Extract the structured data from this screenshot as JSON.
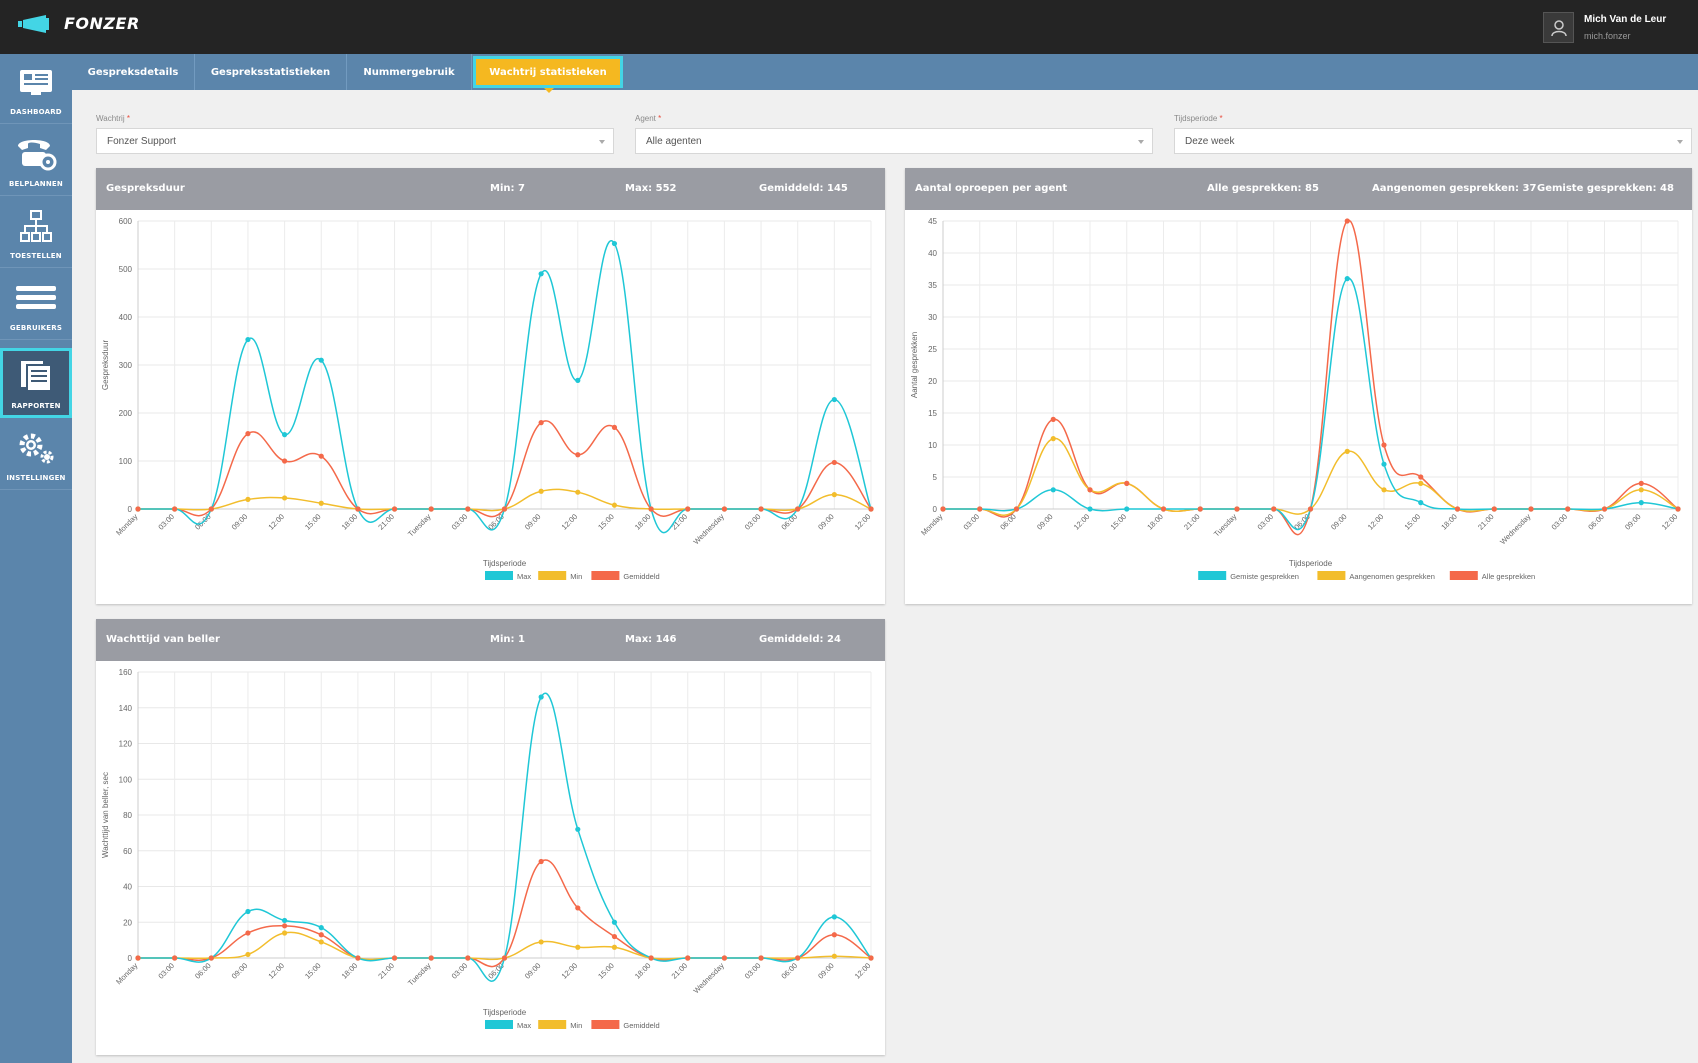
{
  "app": {
    "title": "FONZER"
  },
  "user": {
    "name": "Mich Van de Leur",
    "username": "mich.fonzer"
  },
  "sidebar": {
    "items": [
      {
        "label": "DASHBOARD",
        "icon": "dashboard-icon"
      },
      {
        "label": "BELPLANNEN",
        "icon": "phone-gear-icon"
      },
      {
        "label": "TOESTELLEN",
        "icon": "network-icon"
      },
      {
        "label": "GEBRUIKERS",
        "icon": "menu-icon"
      },
      {
        "label": "RAPPORTEN",
        "icon": "reports-icon",
        "active": true
      },
      {
        "label": "INSTELLINGEN",
        "icon": "gears-icon"
      }
    ]
  },
  "tabs": [
    {
      "label": "Gespreksdetails"
    },
    {
      "label": "Gespreksstatistieken"
    },
    {
      "label": "Nummergebruik"
    },
    {
      "label": "Wachtrij statistieken",
      "active": true
    }
  ],
  "filters": {
    "queue": {
      "label": "Wachtrij",
      "value": "Fonzer Support"
    },
    "agent": {
      "label": "Agent",
      "value": "Alle agenten"
    },
    "period": {
      "label": "Tijdsperiode",
      "value": "Deze week"
    }
  },
  "colors": {
    "max": "#1fc7d6",
    "min": "#f2bd2c",
    "avg": "#f4694a"
  },
  "panels": {
    "duration": {
      "title": "Gespreksduur",
      "min": "Min: 7",
      "max": "Max: 552",
      "avg": "Gemiddeld: 145"
    },
    "calls": {
      "title": "Aantal oproepen per agent",
      "all": "Alle gesprekken: 85",
      "answered": "Aangenomen gesprekken: 37",
      "missed": "Gemiste gesprekken: 48"
    },
    "wait": {
      "title": "Wachttijd van beller",
      "min": "Min: 1",
      "max": "Max: 146",
      "avg": "Gemiddeld: 24"
    }
  },
  "chart_data": [
    {
      "type": "line",
      "categories": [
        "Monday",
        "03:00",
        "06:00",
        "09:00",
        "12:00",
        "15:00",
        "18:00",
        "21:00",
        "Tuesday",
        "03:00",
        "06:00",
        "09:00",
        "12:00",
        "15:00",
        "18:00",
        "21:00",
        "Wednesday",
        "03:00",
        "06:00",
        "09:00",
        "12:00"
      ],
      "ylabel": "Gespreksduur",
      "xlabel": "Tijdsperiode",
      "ylim": [
        0,
        600
      ],
      "yticks": [
        0,
        100,
        200,
        300,
        400,
        500,
        600
      ],
      "series": [
        {
          "name": "Max",
          "color": "#1fc7d6",
          "values": [
            0,
            0,
            0,
            353,
            155,
            310,
            0,
            0,
            0,
            0,
            0,
            490,
            268,
            553,
            0,
            0,
            0,
            0,
            0,
            228,
            0
          ]
        },
        {
          "name": "Min",
          "color": "#f2bd2c",
          "values": [
            0,
            0,
            0,
            20,
            23,
            12,
            0,
            0,
            0,
            0,
            0,
            37,
            35,
            8,
            0,
            0,
            0,
            0,
            0,
            30,
            0
          ]
        },
        {
          "name": "Gemiddeld",
          "color": "#f4694a",
          "values": [
            0,
            0,
            0,
            157,
            100,
            110,
            0,
            0,
            0,
            0,
            0,
            180,
            113,
            170,
            0,
            0,
            0,
            0,
            0,
            97,
            0
          ]
        }
      ]
    },
    {
      "type": "line",
      "categories": [
        "Monday",
        "03:00",
        "06:00",
        "09:00",
        "12:00",
        "15:00",
        "18:00",
        "21:00",
        "Tuesday",
        "03:00",
        "06:00",
        "09:00",
        "12:00",
        "15:00",
        "18:00",
        "21:00",
        "Wednesday",
        "03:00",
        "06:00",
        "09:00",
        "12:00"
      ],
      "ylabel": "Aantal gesprekken",
      "xlabel": "Tijdsperiode",
      "ylim": [
        0,
        45
      ],
      "yticks": [
        0,
        5,
        10,
        15,
        20,
        25,
        30,
        35,
        40,
        45
      ],
      "series": [
        {
          "name": "Gemiste gesprekken",
          "color": "#1fc7d6",
          "values": [
            0,
            0,
            0,
            3,
            0,
            0,
            0,
            0,
            0,
            0,
            0,
            36,
            7,
            1,
            0,
            0,
            0,
            0,
            0,
            1,
            0
          ]
        },
        {
          "name": "Aangenomen gesprekken",
          "color": "#f2bd2c",
          "values": [
            0,
            0,
            0,
            11,
            3,
            4,
            0,
            0,
            0,
            0,
            0,
            9,
            3,
            4,
            0,
            0,
            0,
            0,
            0,
            3,
            0
          ]
        },
        {
          "name": "Alle gesprekken",
          "color": "#f4694a",
          "values": [
            0,
            0,
            0,
            14,
            3,
            4,
            0,
            0,
            0,
            0,
            0,
            45,
            10,
            5,
            0,
            0,
            0,
            0,
            0,
            4,
            0
          ]
        }
      ]
    },
    {
      "type": "line",
      "categories": [
        "Monday",
        "03:00",
        "06:00",
        "09:00",
        "12:00",
        "15:00",
        "18:00",
        "21:00",
        "Tuesday",
        "03:00",
        "06:00",
        "09:00",
        "12:00",
        "15:00",
        "18:00",
        "21:00",
        "Wednesday",
        "03:00",
        "06:00",
        "09:00",
        "12:00"
      ],
      "ylabel": "Wachttijd van beller, sec",
      "xlabel": "Tijdsperiode",
      "ylim": [
        0,
        160
      ],
      "yticks": [
        0,
        20,
        40,
        60,
        80,
        100,
        120,
        140,
        160
      ],
      "series": [
        {
          "name": "Max",
          "color": "#1fc7d6",
          "values": [
            0,
            0,
            0,
            26,
            21,
            17,
            0,
            0,
            0,
            0,
            0,
            146,
            72,
            20,
            0,
            0,
            0,
            0,
            0,
            23,
            0
          ]
        },
        {
          "name": "Min",
          "color": "#f2bd2c",
          "values": [
            0,
            0,
            0,
            2,
            14,
            9,
            0,
            0,
            0,
            0,
            0,
            9,
            6,
            6,
            0,
            0,
            0,
            0,
            0,
            1,
            0
          ]
        },
        {
          "name": "Gemiddeld",
          "color": "#f4694a",
          "values": [
            0,
            0,
            0,
            14,
            18,
            13,
            0,
            0,
            0,
            0,
            0,
            54,
            28,
            12,
            0,
            0,
            0,
            0,
            0,
            13,
            0
          ]
        }
      ]
    }
  ]
}
